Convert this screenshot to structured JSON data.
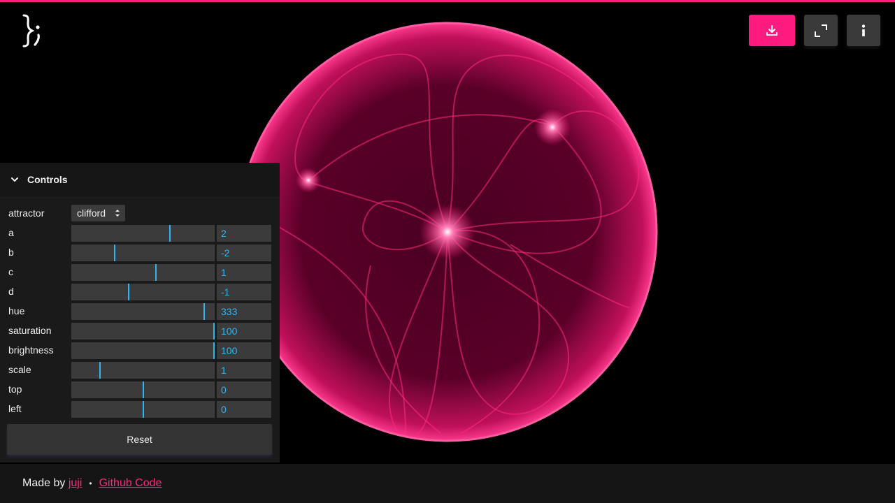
{
  "header": {
    "accent_color": "#ff1f7a",
    "logo_glyph": "};",
    "buttons": [
      {
        "icon": "download-icon",
        "color": "#ff1a7f"
      },
      {
        "icon": "fullscreen-icon",
        "color": "#3a3a3a"
      },
      {
        "icon": "info-icon",
        "color": "#3a3a3a"
      }
    ]
  },
  "attractor_image": {
    "color": "#ff2a80"
  },
  "controls": {
    "title": "Controls",
    "attractor": {
      "label": "attractor",
      "value": "clifford"
    },
    "params": [
      {
        "label": "a",
        "value": "2",
        "fraction": 0.69
      },
      {
        "label": "b",
        "value": "-2",
        "fraction": 0.3
      },
      {
        "label": "c",
        "value": "1",
        "fraction": 0.59
      },
      {
        "label": "d",
        "value": "-1",
        "fraction": 0.4
      },
      {
        "label": "hue",
        "value": "333",
        "fraction": 0.925
      },
      {
        "label": "saturation",
        "value": "100",
        "fraction": 1.0
      },
      {
        "label": "brightness",
        "value": "100",
        "fraction": 1.0
      },
      {
        "label": "scale",
        "value": "1",
        "fraction": 0.2
      },
      {
        "label": "top",
        "value": "0",
        "fraction": 0.5
      },
      {
        "label": "left",
        "value": "0",
        "fraction": 0.5
      }
    ],
    "reset_label": "Reset",
    "slider_color": "#29b6f6"
  },
  "footer": {
    "made_by": "Made by",
    "author": "juji",
    "separator": "•",
    "github": "Github Code"
  }
}
